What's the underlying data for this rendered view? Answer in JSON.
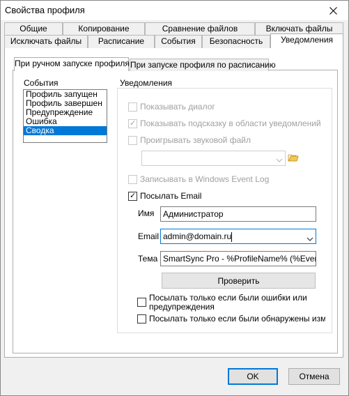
{
  "window": {
    "title": "Свойства профиля"
  },
  "tabs_row1": [
    "Общие",
    "Копирование",
    "Сравнение файлов",
    "Включать файлы"
  ],
  "tabs_row2": [
    "Исключать файлы",
    "Расписание",
    "События",
    "Безопасность",
    "Уведомления"
  ],
  "subtabs": [
    "При ручном запуске профиля",
    "При запуске профиля по расписанию"
  ],
  "events": {
    "label": "События",
    "items": [
      "Профиль запущен",
      "Профиль завершен",
      "Предупреждение",
      "Ошибка",
      "Сводка"
    ],
    "selected": "Сводка"
  },
  "notifications": {
    "label": "Уведомления",
    "show_dialog": "Показывать диалог",
    "show_tooltip": "Показывать подсказку в области уведомлений",
    "play_sound": "Проигрывать звуковой файл",
    "write_event_log": "Записывать в Windows Event Log",
    "send_email": "Посылать Email"
  },
  "email": {
    "name_label": "Имя",
    "name_value": "Администратор",
    "email_label": "Email",
    "email_value": "admin@domain.ru",
    "subject_label": "Тема",
    "subject_value": "SmartSync Pro - %ProfileName% (%Event%)",
    "check_button": "Проверить",
    "only_errors": "Посылать только если были ошибки или предупреждения",
    "only_changes": "Посылать только если были обнаружены изменен"
  },
  "footer": {
    "ok": "OK",
    "cancel": "Отмена"
  },
  "colors": {
    "accent": "#0078d7"
  }
}
